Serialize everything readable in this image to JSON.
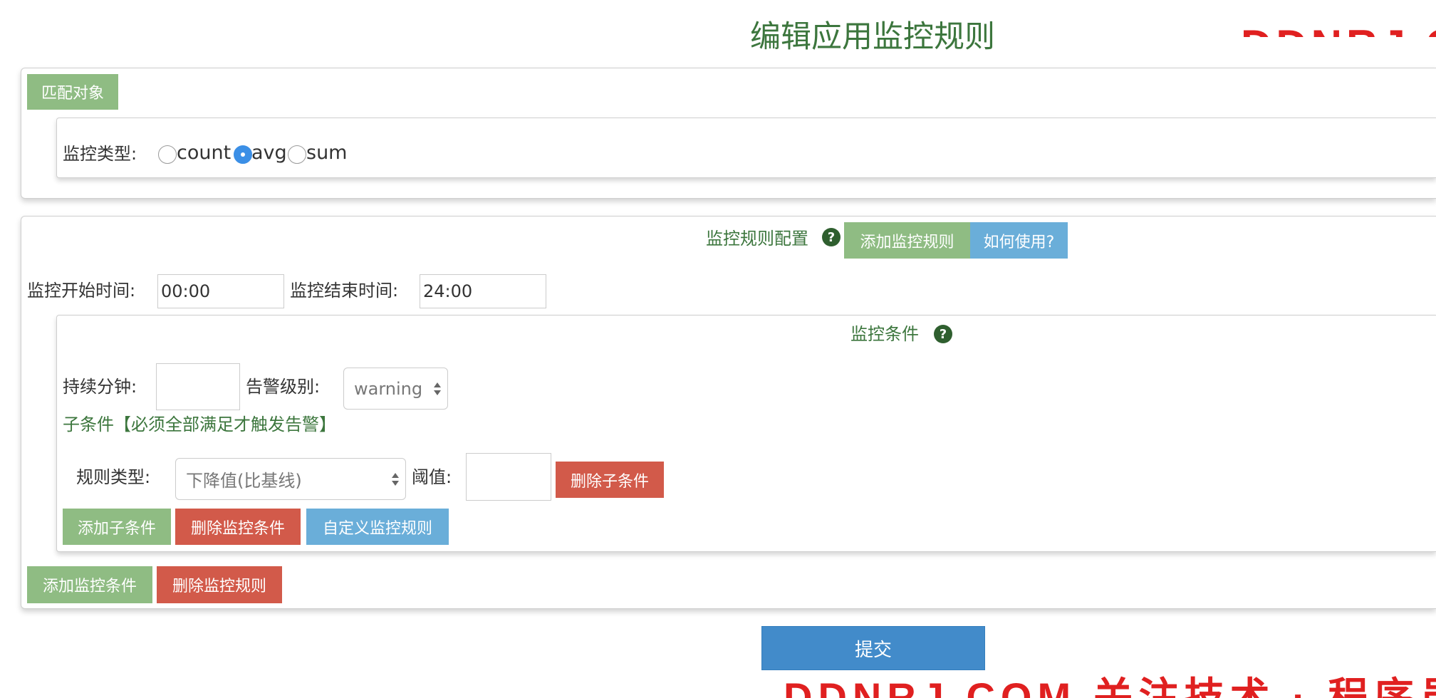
{
  "page": {
    "title": "编辑应用监控规则"
  },
  "watermark": {
    "top": "DDNRJ.COM",
    "bottom": "DDNRJ.COM 关注技术 · 程序员编程资料站"
  },
  "match_panel": {
    "button_label": "匹配对象",
    "monitor_type_label": "监控类型:",
    "monitor_type_options": [
      {
        "label": "count",
        "checked": false
      },
      {
        "label": "avg",
        "checked": true
      },
      {
        "label": "sum",
        "checked": false
      }
    ]
  },
  "rule_panel": {
    "header_label": "监控规则配置",
    "help_icon_glyph": "?",
    "add_rule_label": "添加监控规则",
    "how_to_use_label": "如何使用?",
    "start_time_label": "监控开始时间:",
    "start_time_value": "00:00",
    "end_time_label": "监控结束时间:",
    "end_time_value": "24:00",
    "condition": {
      "header_label": "监控条件",
      "help_icon_glyph": "?",
      "duration_label": "持续分钟:",
      "duration_value": "",
      "alert_level_label": "告警级别:",
      "alert_level_value": "warning",
      "sub_condition_title": "子条件【必须全部满足才触发告警】",
      "rule_type_label": "规则类型:",
      "rule_type_value": "下降值(比基线)",
      "threshold_label": "阈值:",
      "threshold_value": "",
      "delete_sub_label": "删除子条件",
      "add_sub_label": "添加子条件",
      "delete_condition_label": "删除监控条件",
      "custom_rule_label": "自定义监控规则"
    },
    "add_condition_label": "添加监控条件",
    "delete_rule_label": "删除监控规则"
  },
  "submit_label": "提交",
  "colors": {
    "green_button": "#8fbc83",
    "red_button": "#d25a4a",
    "blue_button": "#6aaed9",
    "primary_button": "#428bca",
    "title_green": "#3c763d",
    "watermark_red": "#e02020"
  }
}
